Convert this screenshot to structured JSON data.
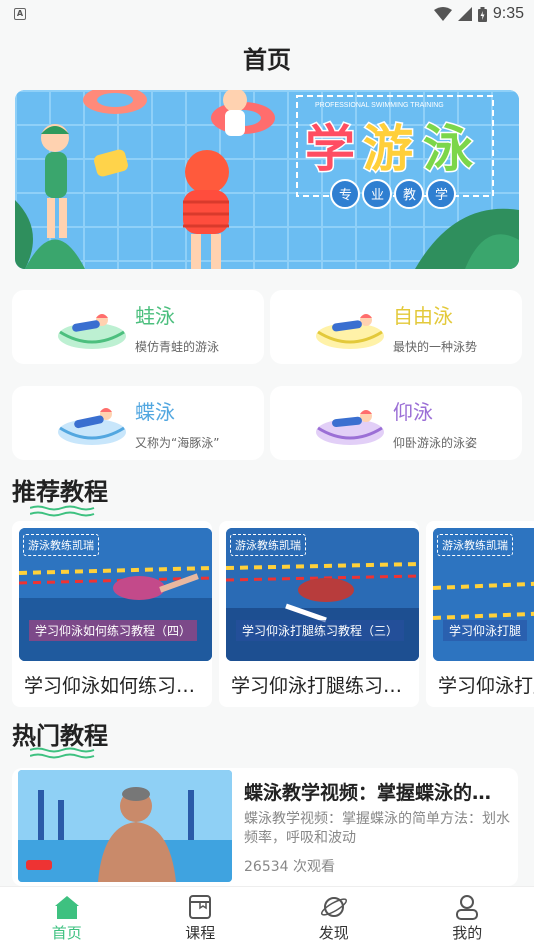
{
  "status_bar": {
    "time": "9:35",
    "notification_icon": "A"
  },
  "page_title": "首页",
  "banner": {
    "subtitle": "PROFESSIONAL SWIMMING TRAINING",
    "headline_1": "学",
    "headline_2": "游",
    "headline_3": "泳",
    "tagline": [
      "专",
      "业",
      "教",
      "学"
    ]
  },
  "strokes": [
    {
      "name": "蛙泳",
      "desc": "模仿青蛙的游泳",
      "color": "#4cbf7e",
      "icon": "breaststroke-swimmer"
    },
    {
      "name": "自由泳",
      "desc": "最快的一种泳势",
      "color": "#e3c93a",
      "icon": "freestyle-swimmer"
    },
    {
      "name": "蝶泳",
      "desc": "又称为“海豚泳”",
      "color": "#52a7e0",
      "icon": "butterfly-swimmer"
    },
    {
      "name": "仰泳",
      "desc": "仰卧游泳的泳姿",
      "color": "#9b6fd6",
      "icon": "backstroke-swimmer"
    }
  ],
  "recommended": {
    "title": "推荐教程",
    "items": [
      {
        "title": "学习仰泳如何练习教程（四）",
        "tag": "游泳教练凯瑞",
        "caption": "学习仰泳如何练习教程（四）"
      },
      {
        "title": "学习仰泳打腿练习教程（三）",
        "tag": "游泳教练凯瑞",
        "caption": "学习仰泳打腿练习教程（三）"
      },
      {
        "title": "学习仰泳打腿练习教程",
        "tag": "游泳教练凯瑞",
        "caption": "学习仰泳打腿"
      }
    ]
  },
  "hot": {
    "title": "热门教程",
    "items": [
      {
        "title": "蝶泳教学视频：掌握蝶泳的简单方法",
        "desc": "蝶泳教学视频：掌握蝶泳的简单方法：划水频率，呼吸和波动",
        "views": "26534 次观看"
      }
    ]
  },
  "tabbar": [
    {
      "label": "首页",
      "icon": "home-icon",
      "active": true
    },
    {
      "label": "课程",
      "icon": "course-icon",
      "active": false
    },
    {
      "label": "发现",
      "icon": "discover-planet-icon",
      "active": false
    },
    {
      "label": "我的",
      "icon": "profile-icon",
      "active": false
    }
  ],
  "colors": {
    "accent": "#3ec180",
    "banner_bg": "#64b9f0"
  }
}
